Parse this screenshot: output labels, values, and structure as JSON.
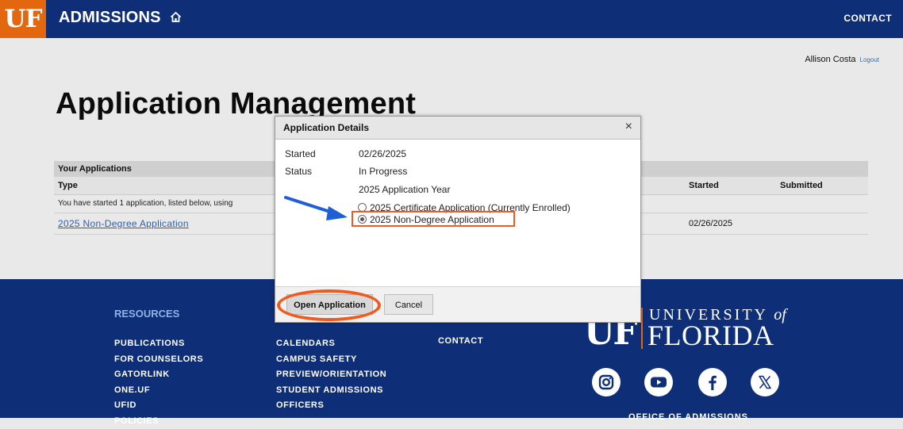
{
  "header": {
    "logo_text": "UF",
    "site_title": "ADMISSIONS",
    "contact_label": "CONTACT"
  },
  "user": {
    "name": "Allison Costa",
    "logout_label": "Logout"
  },
  "page_title": "Application Management",
  "applications": {
    "section_label": "Your Applications",
    "columns": {
      "type": "Type",
      "started": "Started",
      "submitted": "Submitted"
    },
    "note": "You have started 1 application, listed below, using",
    "rows": [
      {
        "type": "2025 Non-Degree Application",
        "started": "02/26/2025",
        "submitted": ""
      }
    ]
  },
  "modal": {
    "title": "Application Details",
    "close_glyph": "×",
    "started_label": "Started",
    "started_value": "02/26/2025",
    "status_label": "Status",
    "status_value": "In Progress",
    "year_label": "2025 Application Year",
    "options": [
      {
        "label": "2025 Certificate Application (Currently Enrolled)",
        "selected": false
      },
      {
        "label": "2025 Non-Degree Application",
        "selected": true
      }
    ],
    "open_button": "Open Application",
    "cancel_button": "Cancel"
  },
  "footer": {
    "resources_heading": "RESOURCES",
    "col1": [
      "PUBLICATIONS",
      "FOR COUNSELORS",
      "GATORLINK",
      "ONE.UF",
      "UFID",
      "POLICIES"
    ],
    "col2": [
      "CALENDARS",
      "CAMPUS SAFETY",
      "PREVIEW/ORIENTATION",
      "STUDENT ADMISSIONS",
      "OFFICERS"
    ],
    "contact": "CONTACT",
    "uf_mark": "UF",
    "university_line1": "UNIVERSITY",
    "university_of": "of",
    "university_line2": "FLORIDA",
    "office": "OFFICE OF ADMISSIONS",
    "social_icons": [
      "instagram-icon",
      "youtube-icon",
      "facebook-icon",
      "x-icon"
    ]
  },
  "colors": {
    "navy": "#0e2f78",
    "orange": "#e2670f",
    "highlight": "#ee5a1f",
    "arrow": "#1f5fd6"
  }
}
